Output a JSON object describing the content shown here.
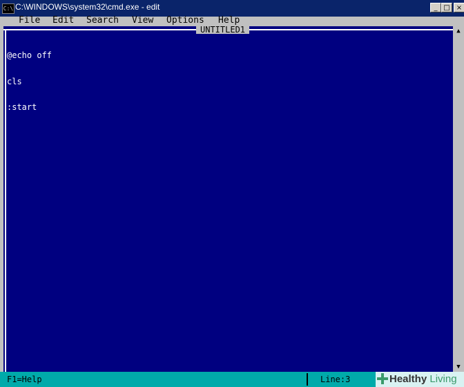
{
  "window": {
    "title": "C:\\WINDOWS\\system32\\cmd.exe - edit",
    "icon_label": "C:\\",
    "min_glyph": "_",
    "max_glyph": "□",
    "close_glyph": "×"
  },
  "menu": {
    "items": [
      "File",
      "Edit",
      "Search",
      "View",
      "Options",
      "Help"
    ]
  },
  "document": {
    "title": "UNTITLED1",
    "lines": [
      "@echo off",
      "cls",
      ":start"
    ]
  },
  "scrollbar": {
    "up_glyph": "▲",
    "down_glyph": "▼"
  },
  "status": {
    "help": "F1=Help",
    "line": "Line:3"
  },
  "watermark": {
    "part1": "Healthy",
    "part2": "Living"
  },
  "colors": {
    "editor_bg": "#000080",
    "status_bg": "#00aaaa",
    "menu_bg": "#c0c0c0",
    "title_bar": "#0a246a"
  }
}
